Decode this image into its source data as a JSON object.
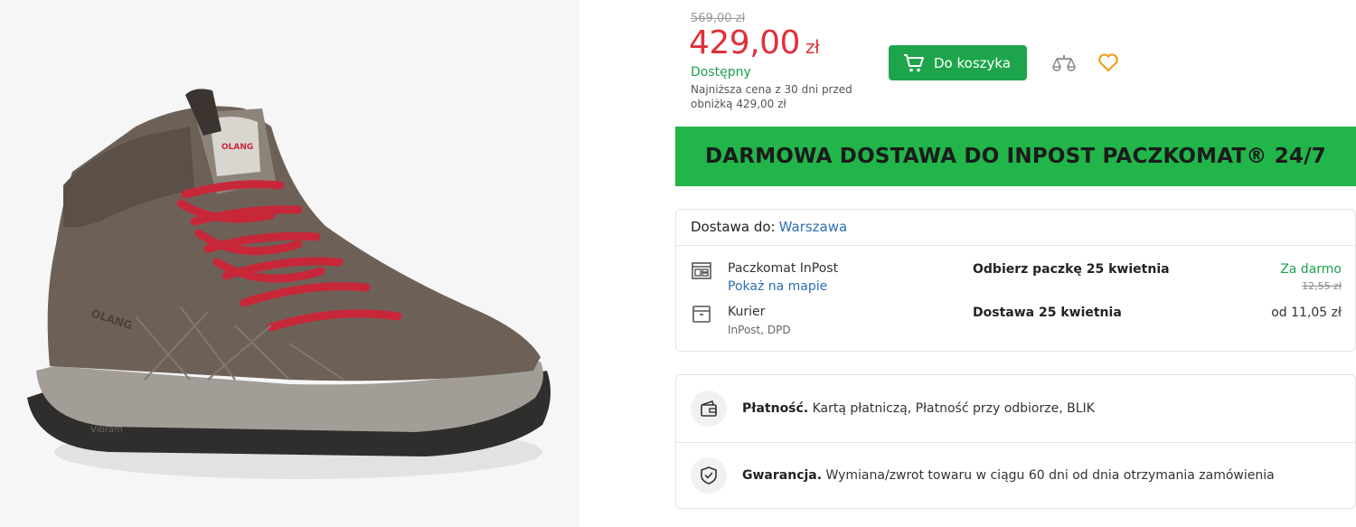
{
  "product": {
    "image_alt": "Brązowy but trekkingowy z czerwonymi sznurówkami",
    "brand_marks": [
      "OLANG",
      "OLANG",
      "Vibram"
    ]
  },
  "pricing": {
    "old_price": "569,00 zł",
    "price_value": "429,00",
    "price_currency": "zł",
    "availability": "Dostępny",
    "lowest_price_note": "Najniższa cena z 30 dni przed obniżką 429,00 zł"
  },
  "actions": {
    "add_to_cart": "Do koszyka",
    "compare_icon": "compare-scales-icon",
    "wishlist_icon": "heart-icon"
  },
  "promo": {
    "banner_text": "DARMOWA DOSTAWA DO INPOST PACZKOMAT® 24/7"
  },
  "delivery": {
    "label": "Dostawa do:",
    "city": "Warszawa",
    "options": [
      {
        "name": "Paczkomat InPost",
        "link": "Pokaż na mapie",
        "date": "Odbierz paczkę 25 kwietnia",
        "price": "Za darmo",
        "old_price": "12,55 zł",
        "icon": "parcel-locker-icon"
      },
      {
        "name": "Kurier",
        "sub": "InPost, DPD",
        "date": "Dostawa 25 kwietnia",
        "price": "od 11,05 zł",
        "icon": "courier-box-icon"
      }
    ]
  },
  "info": {
    "payment_label": "Płatność.",
    "payment_text": "Kartą płatniczą, Płatność przy odbiorze, BLIK",
    "warranty_label": "Gwarancja.",
    "warranty_text": "Wymiana/zwrot towaru w ciągu 60 dni od dnia otrzymania zamówienia"
  },
  "colors": {
    "accent_green": "#1ea54c",
    "banner_green": "#21b54a",
    "price_red": "#e0303a",
    "link_blue": "#2d6fb3",
    "heart_orange": "#f0a020"
  }
}
